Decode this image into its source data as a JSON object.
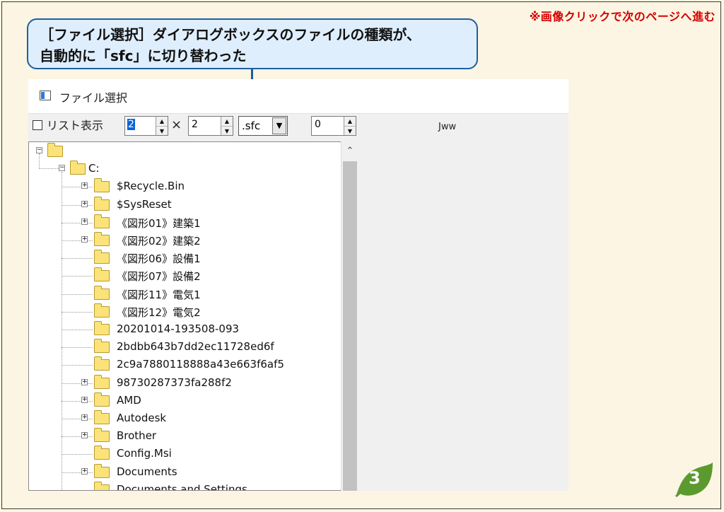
{
  "header": {
    "click_note": "※画像クリックで次のページへ進む"
  },
  "callout": {
    "line1": "［ファイル選択］ダイアログボックスのファイルの種類が、",
    "line2": "自動的に「sfc」に切り替わった"
  },
  "dialog": {
    "title": "ファイル選択",
    "list_view_label": "リスト表示",
    "rows_value": "2",
    "times_symbol": "×",
    "cols_value": "2",
    "file_type_value": ".sfc",
    "offset_value": "0",
    "preview_label": "Jww"
  },
  "tree": {
    "root_drive": "C:",
    "items": [
      {
        "label": "$Recycle.Bin",
        "expandable": true
      },
      {
        "label": "$SysReset",
        "expandable": true
      },
      {
        "label": "《図形01》建築1",
        "expandable": true
      },
      {
        "label": "《図形02》建築2",
        "expandable": true
      },
      {
        "label": "《図形06》設備1",
        "expandable": false
      },
      {
        "label": "《図形07》設備2",
        "expandable": false
      },
      {
        "label": "《図形11》電気1",
        "expandable": false
      },
      {
        "label": "《図形12》電気2",
        "expandable": false
      },
      {
        "label": "20201014-193508-093",
        "expandable": false
      },
      {
        "label": "2bdbb643b7dd2ec11728ed6f",
        "expandable": false
      },
      {
        "label": "2c9a7880118888a43e663f6af5",
        "expandable": false
      },
      {
        "label": "98730287373fa288f2",
        "expandable": true
      },
      {
        "label": "AMD",
        "expandable": true
      },
      {
        "label": "Autodesk",
        "expandable": true
      },
      {
        "label": "Brother",
        "expandable": true
      },
      {
        "label": "Config.Msi",
        "expandable": false
      },
      {
        "label": "Documents",
        "expandable": true
      },
      {
        "label": "Documents and Settings",
        "expandable": false
      }
    ]
  },
  "page_badge": {
    "number": "3",
    "color": "#5a9a2e"
  }
}
